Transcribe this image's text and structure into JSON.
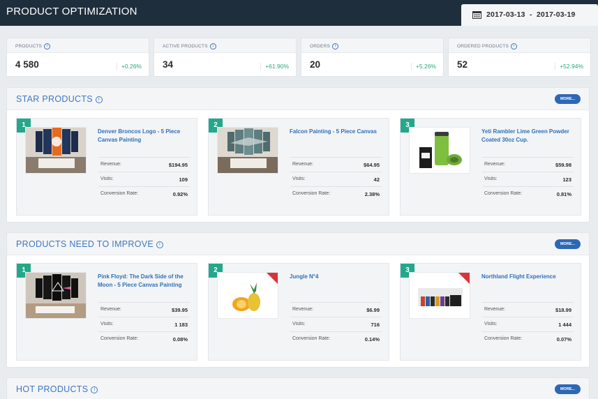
{
  "header": {
    "title": "PRODUCT OPTIMIZATION",
    "date_range": "2017-03-13  -  2017-03-19"
  },
  "kpis": [
    {
      "label": "PRODUCTS",
      "value": "4 580",
      "delta": "+0.26%"
    },
    {
      "label": "ACTIVE PRODUCTS",
      "value": "34",
      "delta": "+61.90%"
    },
    {
      "label": "ORDERS",
      "value": "20",
      "delta": "+5.26%"
    },
    {
      "label": "ORDERED PRODUCTS",
      "value": "52",
      "delta": "+52.94%"
    }
  ],
  "info_glyph": "i",
  "more_label": "MORE...",
  "stat_labels": {
    "revenue": "Revenue:",
    "visits": "Visits:",
    "conversion": "Conversion Rate:"
  },
  "star": {
    "title": "STAR PRODUCTS",
    "products": [
      {
        "rank": "1",
        "name": "Denver Broncos Logo - 5 Piece Canvas Painting",
        "revenue": "$194.95",
        "visits": "109",
        "conversion": "0.92%"
      },
      {
        "rank": "2",
        "name": "Falcon Painting - 5 Piece Canvas",
        "revenue": "$64.95",
        "visits": "42",
        "conversion": "2.38%"
      },
      {
        "rank": "3",
        "name": "Yeti Rambler Lime Green Powder Coated 30oz Cup.",
        "revenue": "$59.98",
        "visits": "123",
        "conversion": "0.81%"
      }
    ]
  },
  "improve": {
    "title": "PRODUCTS NEED TO IMPROVE",
    "products": [
      {
        "rank": "1",
        "name": "Pink Floyd: The Dark Side of the Moon - 5 Piece Canvas Painting",
        "revenue": "$39.95",
        "visits": "1 183",
        "conversion": "0.08%"
      },
      {
        "rank": "2",
        "name": "Jungle N°4",
        "revenue": "$6.99",
        "visits": "716",
        "conversion": "0.14%"
      },
      {
        "rank": "3",
        "name": "Northland Flight Experience",
        "revenue": "$18.99",
        "visits": "1 444",
        "conversion": "0.07%"
      }
    ]
  },
  "hot": {
    "title": "HOT PRODUCTS"
  },
  "colors": {
    "header_bg": "#1f2e3d",
    "accent_blue": "#2d68b6",
    "rank_green": "#23a88a",
    "delta_green": "#27a87a",
    "ribbon_red": "#d9343a"
  },
  "icons": [
    "calendar-icon",
    "chevron-down-icon",
    "info-icon",
    "sale-ribbon-icon"
  ]
}
